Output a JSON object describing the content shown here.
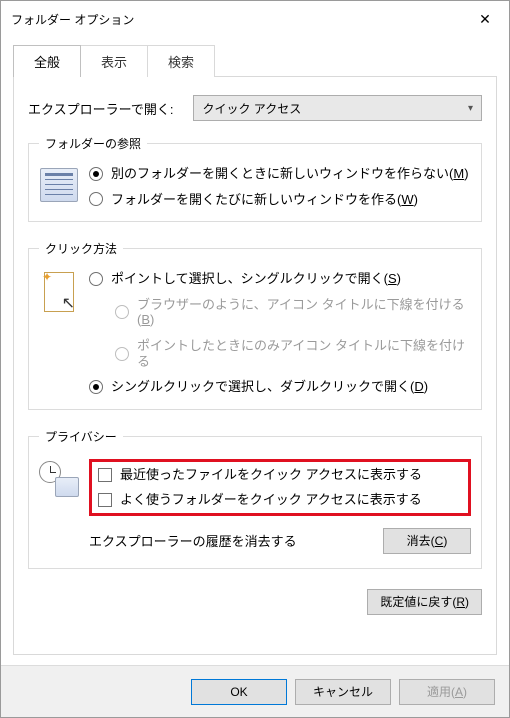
{
  "window": {
    "title": "フォルダー オプション"
  },
  "tabs": {
    "general": "全般",
    "view": "表示",
    "search": "検索"
  },
  "open_with": {
    "label": "エクスプローラーで開く:",
    "value": "クイック アクセス"
  },
  "browse": {
    "legend": "フォルダーの参照",
    "opt1_pre": "別のフォルダーを開くときに新しいウィンドウを作らない(",
    "opt1_u": "M",
    "opt1_post": ")",
    "opt2_pre": "フォルダーを開くたびに新しいウィンドウを作る(",
    "opt2_u": "W",
    "opt2_post": ")"
  },
  "click": {
    "legend": "クリック方法",
    "opt1_pre": "ポイントして選択し、シングルクリックで開く(",
    "opt1_u": "S",
    "opt1_post": ")",
    "sub1_pre": "ブラウザーのように、アイコン タイトルに下線を付ける(",
    "sub1_u": "B",
    "sub1_post": ")",
    "sub2": "ポイントしたときにのみアイコン タイトルに下線を付ける",
    "opt2_pre": "シングルクリックで選択し、ダブルクリックで開く(",
    "opt2_u": "D",
    "opt2_post": ")"
  },
  "privacy": {
    "legend": "プライバシー",
    "chk1": "最近使ったファイルをクイック アクセスに表示する",
    "chk2": "よく使うフォルダーをクイック アクセスに表示する",
    "clear_label": "エクスプローラーの履歴を消去する",
    "clear_btn_pre": "消去(",
    "clear_btn_u": "C",
    "clear_btn_post": ")"
  },
  "defaults_pre": "既定値に戻す(",
  "defaults_u": "R",
  "defaults_post": ")",
  "footer": {
    "ok": "OK",
    "cancel": "キャンセル",
    "apply_pre": "適用(",
    "apply_u": "A",
    "apply_post": ")"
  }
}
